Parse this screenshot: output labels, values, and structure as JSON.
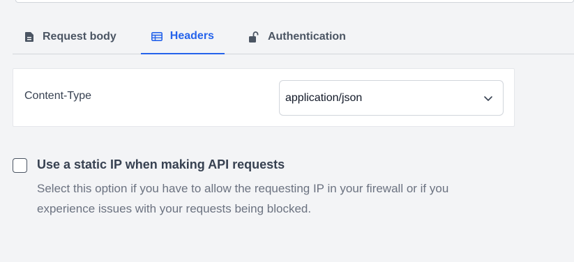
{
  "tabs": [
    {
      "label": "Request body",
      "icon": "document-icon",
      "active": false
    },
    {
      "label": "Headers",
      "icon": "table-icon",
      "active": true
    },
    {
      "label": "Authentication",
      "icon": "unlock-icon",
      "active": false
    }
  ],
  "headers": {
    "key": "Content-Type",
    "value": "application/json"
  },
  "static_ip": {
    "checked": false,
    "title": "Use a static IP when making API requests",
    "description": "Select this option if you have to allow the requesting IP in your firewall or if you experience issues with your requests being blocked."
  },
  "colors": {
    "accent": "#2563eb",
    "background": "#f3f4f6",
    "card": "#ffffff"
  }
}
